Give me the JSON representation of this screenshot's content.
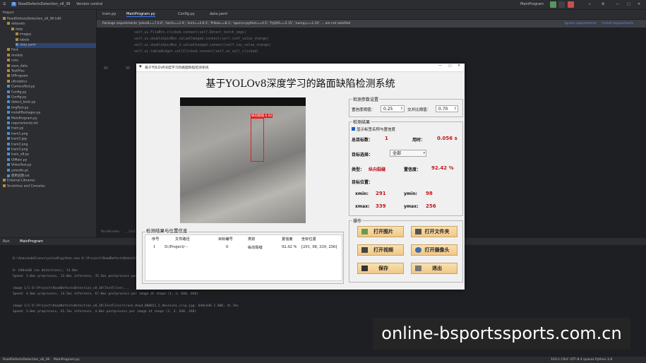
{
  "ide": {
    "title_items": [
      "RoadDefectsDetection_v8_38",
      "Version control",
      "MainProgram",
      "Current File"
    ],
    "tabs": [
      "train.py",
      "MainProgram.py",
      "Config.py",
      "data.yaml"
    ],
    "warning": "Package requirements 'yolov8==7.0.0', 'torch==1.9', 'lxml==4.6.3', 'Pillow==8.1', 'opencv-python==4.5', 'PyQt5==5.15', 'numpy==1.19', ... are not satisfied",
    "warning_actions": [
      "Ignore requirements",
      "Install requirements"
    ],
    "code_lines": [
      "self.ui.FileBtn.clicked.connect(self.Detect_batch_imgs)",
      "self.ui.doubleSpinBox.valueChanged.connect(self.conf_value_change)",
      "self.ui.doubleSpinBox_2.valueChanged.connect(self.iou_value_change)",
      "self.ui.tableWidget.cellClicked.connect(self.on_cell_clicked)"
    ],
    "line_numbers": [
      "89",
      "90"
    ],
    "project_label": "Project",
    "project_tree": [
      "RoadDefectsDetection_v8_38 [v8]",
      "datasets",
      "data",
      "images",
      "labels",
      "data.yaml",
      "Font",
      "models",
      "runs",
      "save_data",
      "TestFiles",
      "UIProgram",
      "ultralytics",
      "CameraTest.py",
      "Config.py",
      "Config.py",
      "detect_tools.py",
      "imgTest.py",
      "installPackages.py",
      "MainProgram.py",
      "requirements.txt",
      "train.py",
      "train1.png",
      "train1.jpg",
      "train2.png",
      "train3.png",
      "train_v8.py",
      "UIMain.py",
      "VideoTest.py",
      "yolov8n.pt",
      "使用说明.txt",
      "External Libraries",
      "Scratches and Consoles"
    ],
    "breadcrumb": "MainWindow  ·  __init__",
    "run_label": "Run",
    "run_tab": "MainProgram",
    "log_lines": [
      "D:\\Anaconda3\\envs\\yolov8\\python.exe D:\\Project\\RoadDefectsDetection_v8_38\\MainProgram.py",
      "",
      "0: 640x640 (no detections), 13.8ms",
      "Speed: 3.0ms preprocess, 13.8ms inference, 35.5ms postprocess per image at shape (1, 3, 640, 640)",
      "",
      "image 1/1 D:\\Project\\RoadDefectsDetection_v8_38\\TestFiles\\...",
      "Speed: 4.0ms preprocess, 14.5ms inference, 67.0ms postprocess per image at shape (1, 3, 640, 640)",
      "",
      "image 1/1 D:\\Project\\RoadDefectsDetection_v8_38\\TestFiles\\Crack_Road_000011_2_Absolute_clip.jpg: 640x448 1 000, 41.7ms",
      "Speed: 3.0ms preprocess, 41.7ms inference, 4.0ms postprocess per image at shape (1, 3, 640, 448)"
    ],
    "status_items": [
      "RoadDefectsDetection_v8_38",
      "MainProgram.py"
    ],
    "status_right": "103:1  CRLF  UTF-8  4 spaces  Python 3.8"
  },
  "app": {
    "window_title": "基于YOLOv8深度学习的路面缺陷检测系统",
    "heading": "基于YOLOv8深度学习的路面缺陷检测系统",
    "box_label": "纵向裂缝 0.92",
    "params": {
      "group": "检测参数设置",
      "conf_label": "置信度阈值：",
      "conf_value": "0.25",
      "iou_label": "交并比阈值：",
      "iou_value": "0.70"
    },
    "results": {
      "group": "检测结果",
      "show_label_checkbox": "显示标签名称与置信度",
      "total_label": "总目标数：",
      "total_value": "1",
      "time_label": "用时：",
      "time_value": "0.056 s",
      "select_label": "目标选择：",
      "select_value": "全部",
      "type_label": "类型：",
      "type_value": "纵向裂缝",
      "conf_label": "置信度：",
      "conf_value": "92.42 %",
      "pos_label": "目标位置：",
      "xmin_label": "xmin:",
      "xmin_value": "291",
      "ymin_label": "ymin:",
      "ymin_value": "98",
      "xmax_label": "xmax:",
      "xmax_value": "339",
      "ymax_label": "ymax:",
      "ymax_value": "256"
    },
    "ops": {
      "group": "操作",
      "open_image": "打开图片",
      "open_folder": "打开文件夹",
      "open_video": "打开视频",
      "open_camera": "打开摄像头",
      "save": "保存",
      "exit": "退出"
    },
    "table": {
      "group": "检测结果与位置信息",
      "headers": [
        "序号",
        "文件路径",
        "目标编号",
        "类别",
        "置信度",
        "坐标位置"
      ],
      "rows": [
        [
          "1",
          "D:/Project/···",
          "0",
          "纵向裂缝",
          "92.42 %",
          "[291, 98, 339, 256]"
        ]
      ]
    }
  },
  "watermark": "online-bsportssports.com.cn",
  "colors": {
    "accent_red": "#c0161b",
    "button": "#f0c888",
    "ide_bg": "#1e1f22"
  }
}
